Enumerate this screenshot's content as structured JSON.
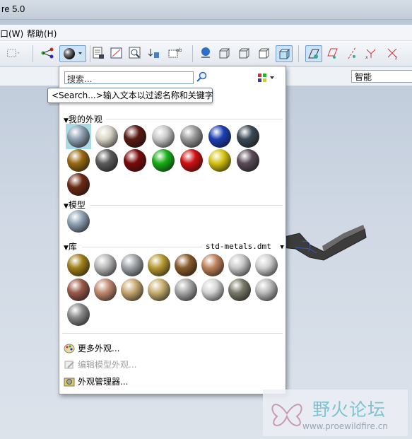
{
  "window": {
    "title": "re 5.0"
  },
  "menubar": {
    "items": [
      "口(W)",
      "帮助(H)"
    ]
  },
  "filterbar": {
    "smart_select": "智能"
  },
  "appearance_popup": {
    "search": {
      "value": "搜索...",
      "tooltip": "<Search...>输入文本以过滤名称和关键字"
    },
    "sections": {
      "my_appearances": "我的外观",
      "model": "模型",
      "library": "库",
      "library_file": "std-metals.dmt"
    },
    "my_swatches": [
      {
        "name": "my-swatch-1",
        "color": "#8fa1b4"
      },
      {
        "name": "my-swatch-2",
        "color": "#d9d5c7"
      },
      {
        "name": "my-swatch-3",
        "color": "#5a1a12"
      },
      {
        "name": "my-swatch-4",
        "color": "#c9c9c9"
      },
      {
        "name": "my-swatch-5",
        "color": "#9a9a9a"
      },
      {
        "name": "my-swatch-6",
        "color": "#1c3fb4"
      },
      {
        "name": "my-swatch-7",
        "color": "#3b4a56"
      },
      {
        "name": "my-swatch-8",
        "color": "#9a6a12"
      },
      {
        "name": "my-swatch-9",
        "color": "#5c5c5c"
      },
      {
        "name": "my-swatch-10",
        "color": "#7a0a0a"
      },
      {
        "name": "my-swatch-11",
        "color": "#18b018"
      },
      {
        "name": "my-swatch-12",
        "color": "#d01010"
      },
      {
        "name": "my-swatch-13",
        "color": "#d6c414"
      },
      {
        "name": "my-swatch-14",
        "color": "#5b4a58"
      },
      {
        "name": "my-swatch-15",
        "color": "#6b2a14"
      }
    ],
    "model_swatches": [
      {
        "name": "model-swatch-1",
        "color": "#8fa1b4"
      }
    ],
    "library_swatches": [
      {
        "name": "lib-swatch-1",
        "color": "#a0801a"
      },
      {
        "name": "lib-swatch-2",
        "color": "#b8b8b8"
      },
      {
        "name": "lib-swatch-3",
        "color": "#a0a4a8"
      },
      {
        "name": "lib-swatch-4",
        "color": "#b89a30"
      },
      {
        "name": "lib-swatch-5",
        "color": "#8a5a2a"
      },
      {
        "name": "lib-swatch-6",
        "color": "#c0825a"
      },
      {
        "name": "lib-swatch-7",
        "color": "#c8c8c8"
      },
      {
        "name": "lib-swatch-8",
        "color": "#d0d0d0"
      },
      {
        "name": "lib-swatch-9",
        "color": "#9a5a4a"
      },
      {
        "name": "lib-swatch-10",
        "color": "#c08a70"
      },
      {
        "name": "lib-swatch-11",
        "color": "#c8a870"
      },
      {
        "name": "lib-swatch-12",
        "color": "#c8b070"
      },
      {
        "name": "lib-swatch-13",
        "color": "#a8a8a8"
      },
      {
        "name": "lib-swatch-14",
        "color": "#d4d4d4"
      },
      {
        "name": "lib-swatch-15",
        "color": "#7a7a6a"
      },
      {
        "name": "lib-swatch-16",
        "color": "#bcbcbc"
      },
      {
        "name": "lib-swatch-17",
        "color": "#8a8a8a"
      }
    ],
    "menu": {
      "more": "更多外观...",
      "edit_model": "编辑模型外观...",
      "manager": "外观管理器..."
    }
  },
  "watermark": {
    "title": "野火论坛",
    "url": "www.proewildfire.cn"
  }
}
